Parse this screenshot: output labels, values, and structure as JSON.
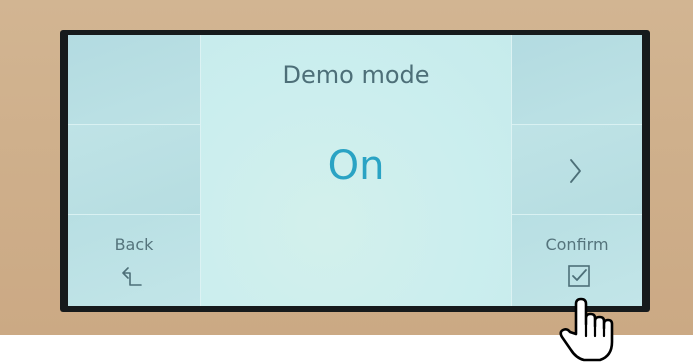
{
  "screen": {
    "title": "Demo mode",
    "value": "On"
  },
  "buttons": {
    "back_label": "Back",
    "next_label": "",
    "confirm_label": "Confirm"
  },
  "icons": {
    "back": "back-arrow-icon",
    "next": "chevron-right-icon",
    "confirm": "checkbox-check-icon",
    "pointer": "hand-pointer-icon"
  },
  "colors": {
    "value_accent": "#2aa3c4",
    "text": "#4d6f78",
    "side_panel": "#b7dde2",
    "center_panel": "#c8ecec",
    "bezel": "#161a1c",
    "device_body": "#d2b592"
  }
}
